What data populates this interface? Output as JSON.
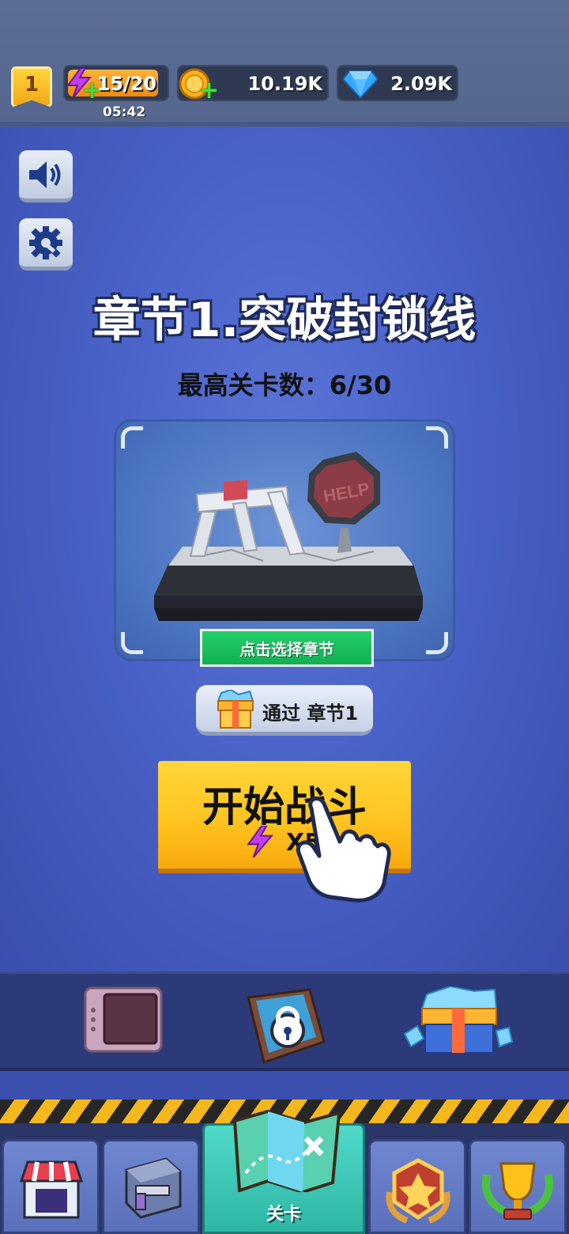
{
  "status_bar": {
    "player_level": "1",
    "energy": "15/20",
    "energy_timer": "05:42",
    "gold": "10.19K",
    "gems": "2.09K"
  },
  "side_buttons": {
    "sound_icon": "speaker-icon",
    "settings_icon": "gear-wrench-icon"
  },
  "chapter": {
    "title": "章节1.突破封锁线",
    "max_level_label": "最高关卡数：",
    "max_level_value": "6/30",
    "select_button": "点击选择章节",
    "reward_label": "通过 章节1",
    "sign_text": "HELP"
  },
  "start_button": {
    "label": "开始战斗",
    "cost": "X5"
  },
  "features": [
    {
      "icon": "safe-icon"
    },
    {
      "icon": "locked-chest-icon"
    },
    {
      "icon": "gem-chest-icon"
    }
  ],
  "bottom_nav": [
    {
      "icon": "shop-icon",
      "label": ""
    },
    {
      "icon": "weapon-crate-icon",
      "label": ""
    },
    {
      "icon": "map-icon",
      "label": "关卡",
      "active": true
    },
    {
      "icon": "rank-badge-icon",
      "label": ""
    },
    {
      "icon": "trophy-icon",
      "label": ""
    }
  ],
  "colors": {
    "background": "#4962c8",
    "start_button": "#ffc41f",
    "select_button": "#12b052",
    "active_tab": "#2eb6a5"
  }
}
